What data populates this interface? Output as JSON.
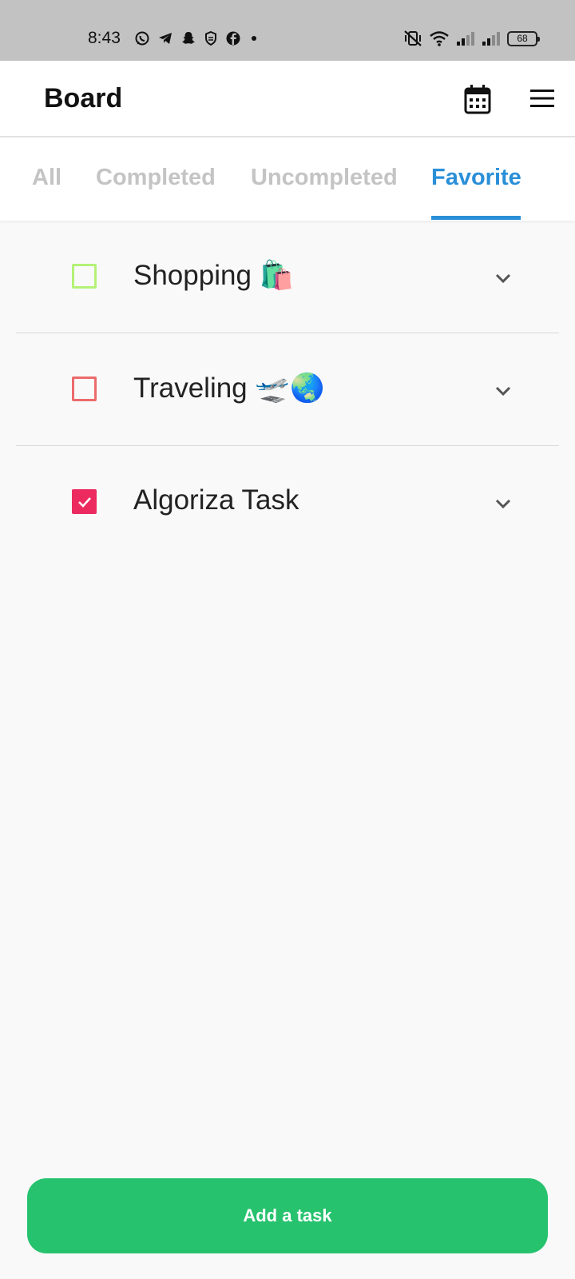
{
  "status_bar": {
    "time": "8:43",
    "notification_icons": [
      "whatsapp-icon",
      "telegram-icon",
      "snapchat-icon",
      "shield-icon",
      "facebook-icon",
      "dot-icon"
    ],
    "system_icons": [
      "vibrate-muted-icon",
      "wifi-icon",
      "signal-icon",
      "signal-icon"
    ],
    "battery": "68"
  },
  "app_bar": {
    "title": "Board",
    "icons": [
      "calendar-icon",
      "menu-icon"
    ]
  },
  "tabs": [
    {
      "label": "All",
      "active": false
    },
    {
      "label": "Completed",
      "active": false
    },
    {
      "label": "Uncompleted",
      "active": false
    },
    {
      "label": "Favorite",
      "active": true
    }
  ],
  "tasks": [
    {
      "title": "Shopping 🛍️",
      "checked": false,
      "color": "#b3f277"
    },
    {
      "title": "Traveling 🛫🌏",
      "checked": false,
      "color": "#ec6b6b"
    },
    {
      "title": "Algoriza Task",
      "checked": true,
      "color": "#ec2a5f"
    }
  ],
  "add_button": {
    "label": "Add a task"
  },
  "colors": {
    "accent": "#2a8fd8",
    "button": "#26c26e",
    "status_bar": "#c2c2c2",
    "inactive_tab": "#c4c4c4"
  }
}
